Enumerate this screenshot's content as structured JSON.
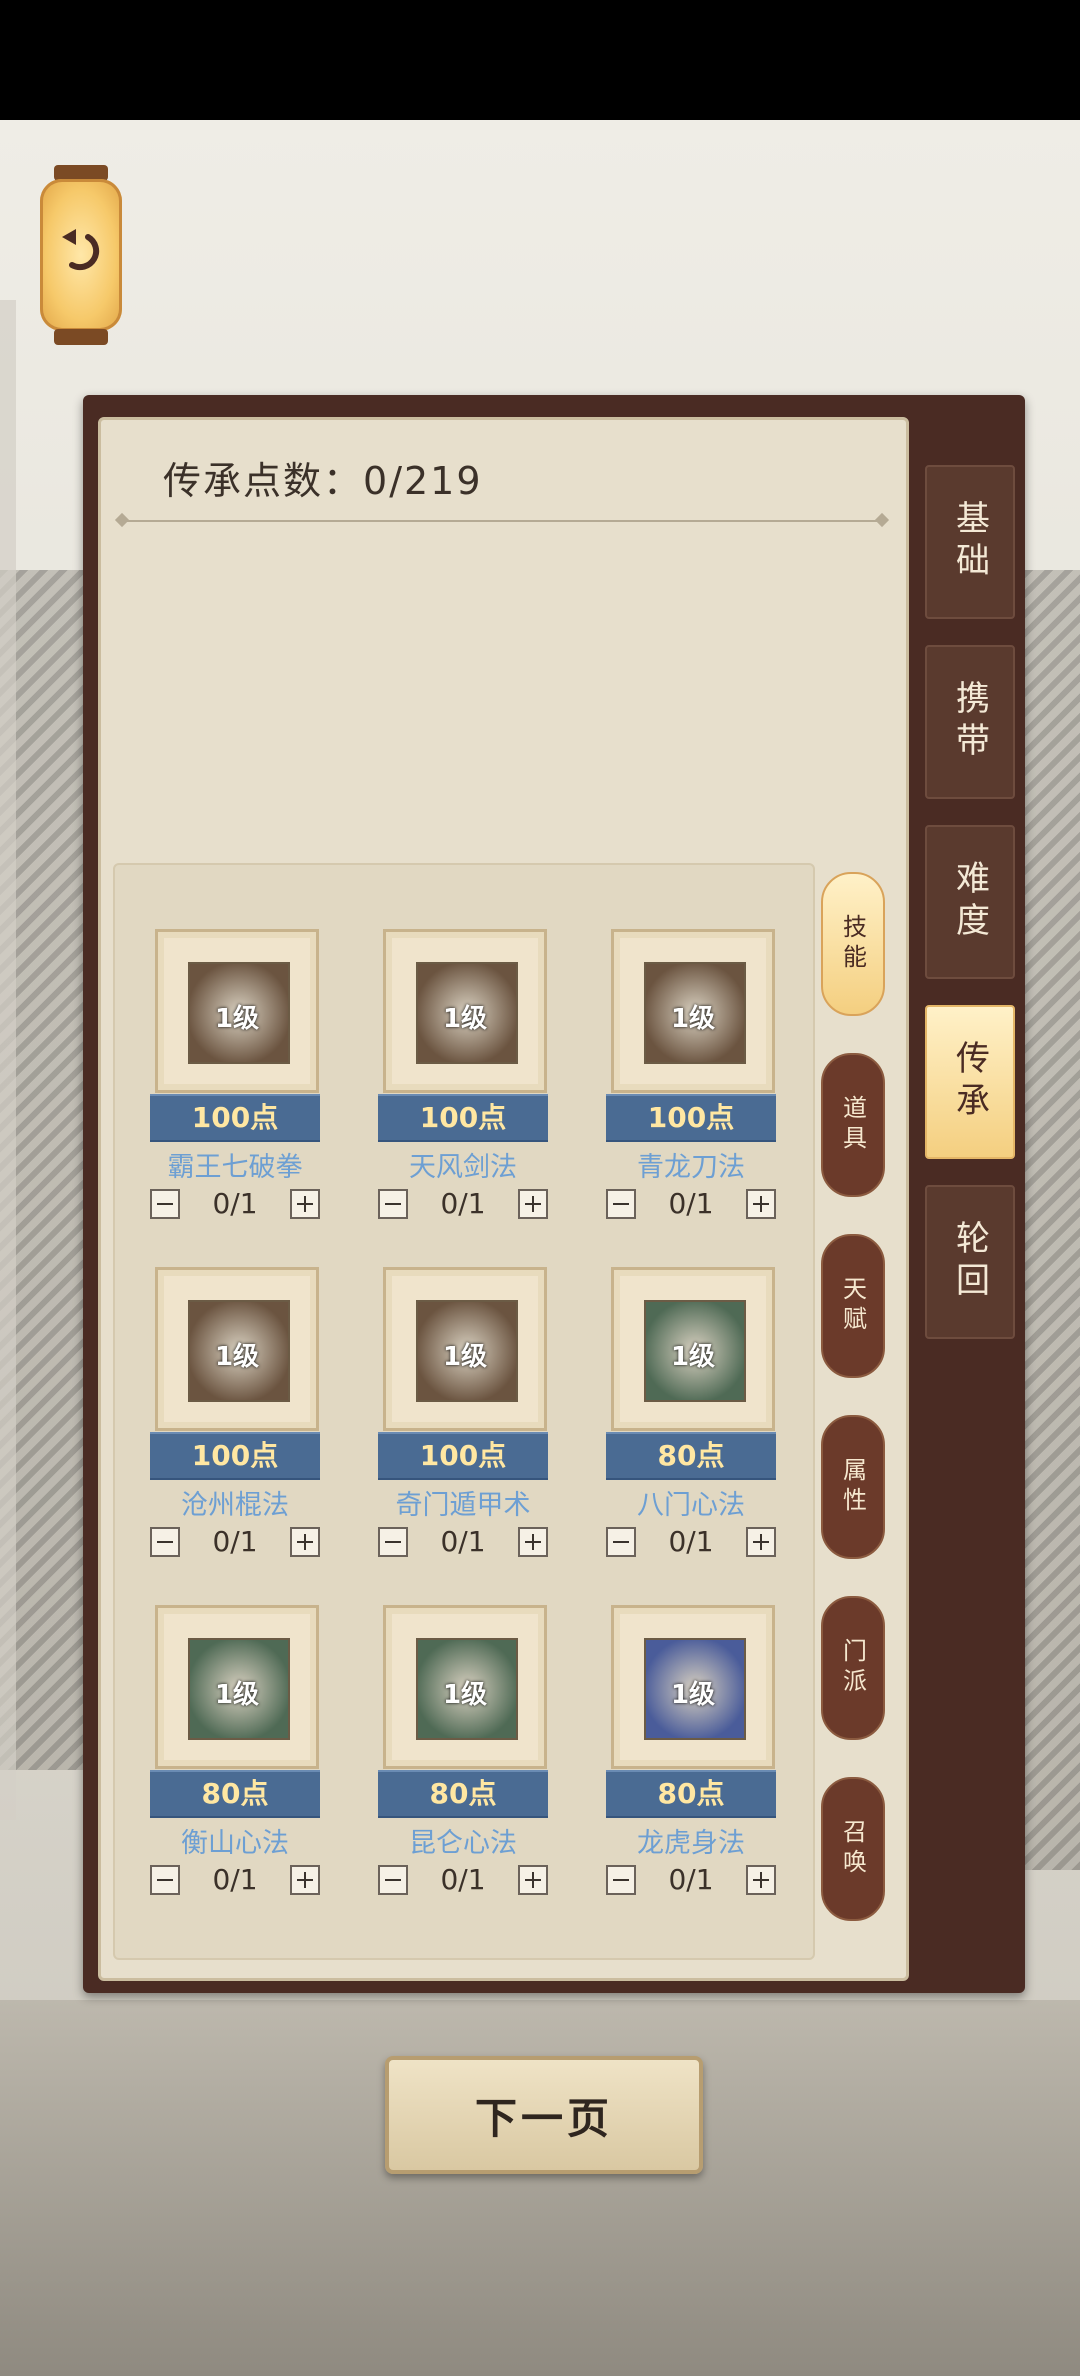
{
  "header": {
    "points_label": "传承点数：",
    "points_value": "0/219"
  },
  "right_tabs": [
    {
      "label": "基础",
      "active": false
    },
    {
      "label": "携带",
      "active": false
    },
    {
      "label": "难度",
      "active": false
    },
    {
      "label": "传承",
      "active": true
    },
    {
      "label": "轮回",
      "active": false
    }
  ],
  "sub_tabs": [
    {
      "label": "技能",
      "active": true
    },
    {
      "label": "道具",
      "active": false
    },
    {
      "label": "天赋",
      "active": false
    },
    {
      "label": "属性",
      "active": false
    },
    {
      "label": "门派",
      "active": false
    },
    {
      "label": "召唤",
      "active": false
    }
  ],
  "skills": [
    {
      "name": "霸王七破拳",
      "level": "1级",
      "cost": "100点",
      "count": "0/1",
      "tint": "#6b5440"
    },
    {
      "name": "天风剑法",
      "level": "1级",
      "cost": "100点",
      "count": "0/1",
      "tint": "#6b5440"
    },
    {
      "name": "青龙刀法",
      "level": "1级",
      "cost": "100点",
      "count": "0/1",
      "tint": "#6b5440"
    },
    {
      "name": "沧州棍法",
      "level": "1级",
      "cost": "100点",
      "count": "0/1",
      "tint": "#6b5440"
    },
    {
      "name": "奇门遁甲术",
      "level": "1级",
      "cost": "100点",
      "count": "0/1",
      "tint": "#6b5440"
    },
    {
      "name": "八门心法",
      "level": "1级",
      "cost": "80点",
      "count": "0/1",
      "tint": "#4f6a55"
    },
    {
      "name": "衡山心法",
      "level": "1级",
      "cost": "80点",
      "count": "0/1",
      "tint": "#4f6a55"
    },
    {
      "name": "昆仑心法",
      "level": "1级",
      "cost": "80点",
      "count": "0/1",
      "tint": "#4f6a55"
    },
    {
      "name": "龙虎身法",
      "level": "1级",
      "cost": "80点",
      "count": "0/1",
      "tint": "#4a5c9a"
    }
  ],
  "footer": {
    "next_page": "下一页"
  }
}
